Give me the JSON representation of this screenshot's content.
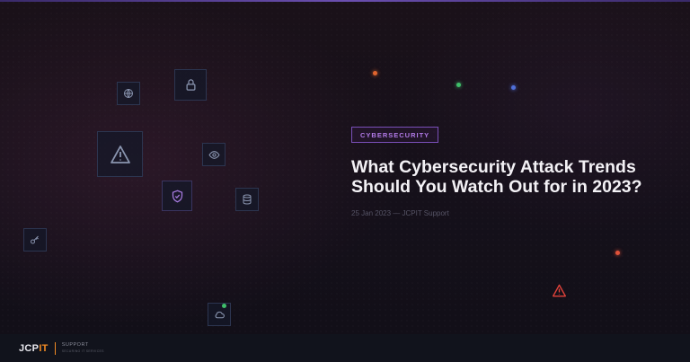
{
  "article": {
    "category": "CYBERSECURITY",
    "title": "What Cybersecurity Attack Trends Should You Watch Out for in 2023?",
    "meta": "25 Jan 2023 — JCPIT Support"
  },
  "footer": {
    "logo_main": "JCP",
    "logo_accent": "IT",
    "support_label": "SUPPORT",
    "support_tagline": "SECURING IT SERVICES"
  },
  "icons": [
    "globe-icon",
    "lock-icon",
    "warning-icon",
    "eye-icon",
    "shield-check-icon",
    "database-icon",
    "key-icon",
    "cloud-icon",
    "alert-triangle-icon"
  ],
  "colors": {
    "accent_purple": "#b27ae8",
    "brand_orange": "#f08a24",
    "dot_orange": "#e0652e",
    "dot_green": "#3fbf6a",
    "dot_blue": "#4f6fd8",
    "alert_red": "#e0423a"
  }
}
